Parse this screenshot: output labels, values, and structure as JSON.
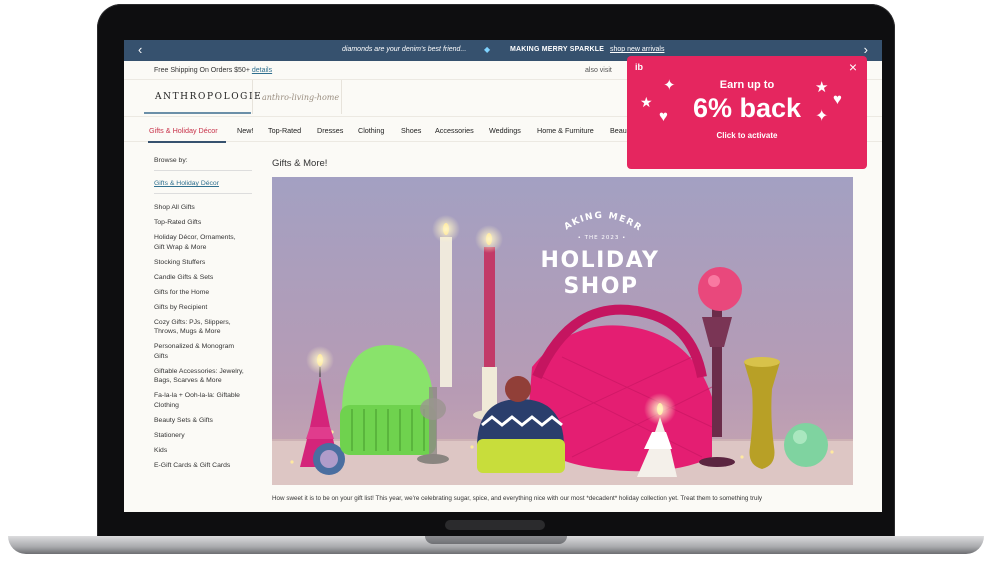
{
  "promo": {
    "message": "diamonds are your denim's best friend...",
    "headline": "MAKING MERRY SPARKLE",
    "link": "shop new arrivals",
    "prev_icon": "chevron-left-icon",
    "next_icon": "chevron-right-icon"
  },
  "utility": {
    "shipping": "Free Shipping On Orders $50+",
    "details": "details",
    "also_visit": "also visit"
  },
  "logos": {
    "anthropologie": "ANTHROPOLOGIE",
    "anthro_home": "anthro-living-home"
  },
  "nav": {
    "items": [
      "Gifts & Holiday Décor",
      "New!",
      "Top-Rated",
      "Dresses",
      "Clothing",
      "Shoes",
      "Accessories",
      "Weddings",
      "Home & Furniture",
      "Beau"
    ]
  },
  "sidebar": {
    "heading": "Browse by:",
    "selected": "Gifts & Holiday Décor",
    "items": [
      "Shop All Gifts",
      "Top-Rated Gifts",
      "Holiday Décor, Ornaments,\nGift Wrap & More",
      "Stocking Stuffers",
      "Candle Gifts & Sets",
      "Gifts for the Home",
      "Gifts by Recipient",
      "Cozy Gifts: PJs, Slippers,\nThrows, Mugs & More",
      "Personalized & Monogram\nGifts",
      "Giftable Accessories: Jewelry,\nBags, Scarves & More",
      "Fa-la-la + Ooh-la-la: Giftable\nClothing",
      "Beauty Sets & Gifts",
      "Stationery",
      "Kids",
      "E-Gift Cards & Gift Cards"
    ]
  },
  "main": {
    "title": "Gifts & More!",
    "hero": {
      "arc_text": "MAKING MERRY",
      "small_text": "• THE 2023 •",
      "title_line1": "HOLIDAY",
      "title_line2": "SHOP"
    },
    "body": "How sweet it is to be on your gift list! This year, we're celebrating sugar, spice, and everything nice with our most *decadent* holiday collection yet. Treat them to something truly"
  },
  "popup": {
    "brand": "ib",
    "earn": "Earn up to",
    "percent": "6% back",
    "cta": "Click to activate",
    "close_icon": "close-icon",
    "color": "#e5265f"
  }
}
